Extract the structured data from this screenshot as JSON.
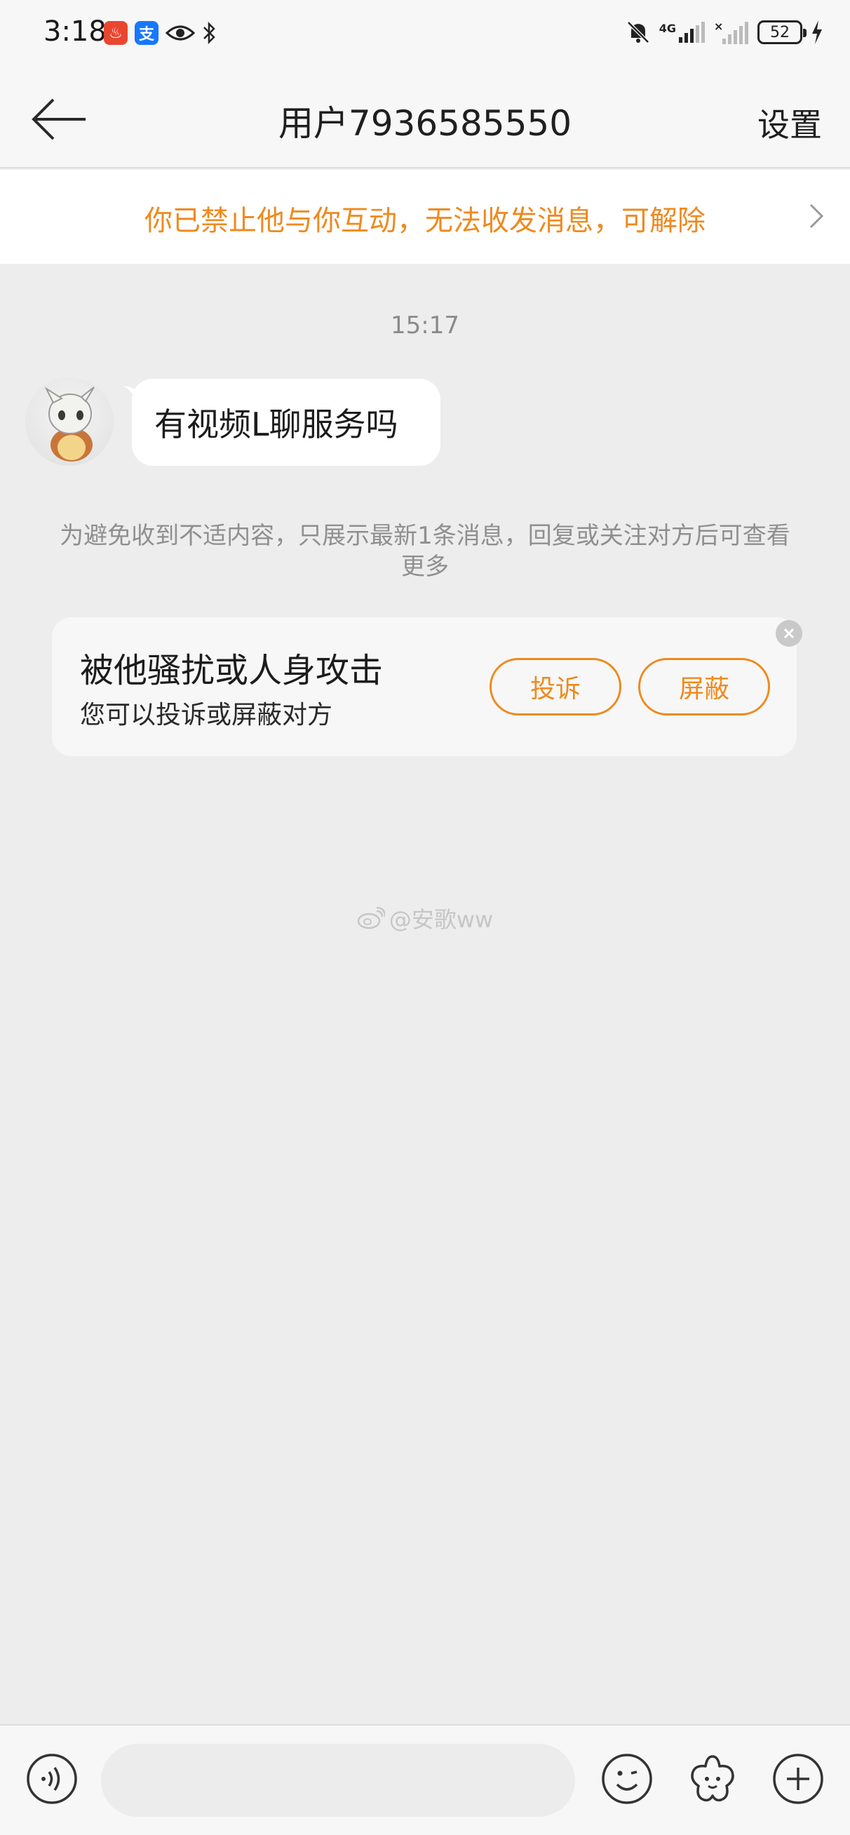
{
  "status_bar": {
    "time": "3:18",
    "app_badges": [
      {
        "glyph": "♨",
        "color": "#e8462f"
      },
      {
        "glyph": "支",
        "color": "#1677ff"
      }
    ],
    "network_label": "4G",
    "battery": "52"
  },
  "header": {
    "title": "用户7936585550",
    "settings_label": "设置"
  },
  "block_banner": {
    "text": "你已禁止他与你互动，无法收发消息，可解除"
  },
  "chat": {
    "timestamp": "15:17",
    "messages": [
      {
        "text": "有视频L聊服务吗"
      }
    ],
    "notice": "为避免收到不适内容，只展示最新1条消息，回复或关注对方后可查看更多"
  },
  "safety_card": {
    "title": "被他骚扰或人身攻击",
    "subtitle": "您可以投诉或屏蔽对方",
    "report_label": "投诉",
    "block_label": "屏蔽"
  },
  "watermark": {
    "text": "@安歌ww"
  },
  "input_bar": {
    "placeholder": ""
  },
  "colors": {
    "accent": "#ee8a1f",
    "background": "#ededed",
    "bar": "#f7f7f7"
  }
}
